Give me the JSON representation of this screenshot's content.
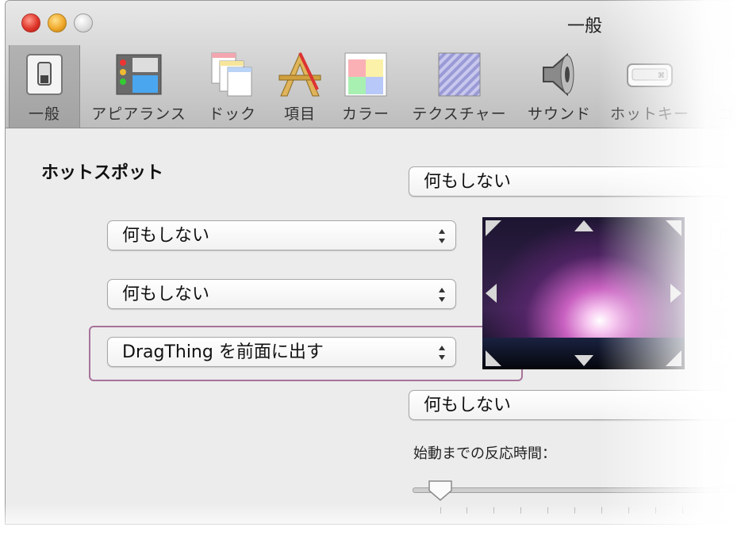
{
  "window": {
    "title": "一般"
  },
  "toolbar": {
    "items": [
      {
        "label": "一般",
        "icon": "switch-icon",
        "selected": true
      },
      {
        "label": "アピアランス",
        "icon": "appearance-icon"
      },
      {
        "label": "ドック",
        "icon": "docks-icon"
      },
      {
        "label": "項目",
        "icon": "tools-icon"
      },
      {
        "label": "カラー",
        "icon": "color-palette-icon"
      },
      {
        "label": "テクスチャー",
        "icon": "texture-icon"
      },
      {
        "label": "サウンド",
        "icon": "speaker-icon"
      },
      {
        "label": "ホットキー",
        "icon": "keyboard-key-icon"
      },
      {
        "label": "ゴ",
        "icon": "trash-icon"
      }
    ]
  },
  "hotspot": {
    "title": "ホットスポット",
    "top_value": "何もしない",
    "left_top_value": "何もしない",
    "left_middle_value": "何もしない",
    "left_bottom_value": "DragThing を前面に出す",
    "bottom_value": "何もしない",
    "right_top_value": "何",
    "right_middle_value": "何",
    "right_bottom_value": "何"
  },
  "delay": {
    "label": "始動までの反応時間：",
    "value": "0.2"
  }
}
